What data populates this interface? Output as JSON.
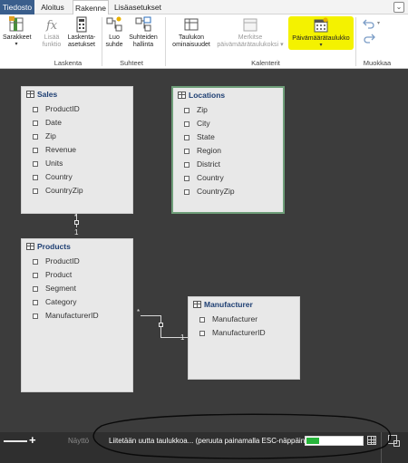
{
  "tabs": [
    "Tiedosto",
    "Aloitus",
    "Rakenne",
    "Lisäasetukset"
  ],
  "ribbon": {
    "columns_btn": "Sarakkeet",
    "new_function_btn": [
      "Lisää",
      "funktio"
    ],
    "calc_columns_btn": [
      "Laskenta-",
      "asetukset"
    ],
    "new_rel_btn": [
      "Luo",
      "suhde"
    ],
    "manage_rel_btn": [
      "Suhteiden",
      "hallinta"
    ],
    "table_props_btn": [
      "Taulukon",
      "ominaisuudet"
    ],
    "mark_date_btn": [
      "Merkitse",
      "päivämäärätaulukoksi"
    ],
    "date_table_btn": "Päivämäärätaulukko",
    "groups": {
      "calc": "Laskenta",
      "relations": "Suhteet",
      "calendars": "Kalenterit",
      "edit": "Muokkaa"
    }
  },
  "tables": {
    "sales": {
      "title": "Sales",
      "fields": [
        "ProductID",
        "Date",
        "Zip",
        "Revenue",
        "Units",
        "Country",
        "CountryZip"
      ]
    },
    "locations": {
      "title": "Locations",
      "fields": [
        "Zip",
        "City",
        "State",
        "Region",
        "District",
        "Country",
        "CountryZip"
      ]
    },
    "products": {
      "title": "Products",
      "fields": [
        "ProductID",
        "Product",
        "Segment",
        "Category",
        "ManufacturerID"
      ]
    },
    "manufacturer": {
      "title": "Manufacturer",
      "fields": [
        "Manufacturer",
        "ManufacturerID"
      ]
    }
  },
  "relationships": {
    "sales_products": {
      "many": "*",
      "one": "1"
    },
    "products_manufacturer": {
      "many": "*",
      "one": "1"
    }
  },
  "status": {
    "view_label": "Näyttö",
    "loading": "Liitetään uutta taulukkoa... (peruuta painamalla ESC-näppäintä)",
    "progress": 0.22
  },
  "colors": {
    "file_tab": "#3a5e8c",
    "highlight": "#f4f200",
    "selected_border": "#6e9e79",
    "progress": "#27b43b"
  }
}
